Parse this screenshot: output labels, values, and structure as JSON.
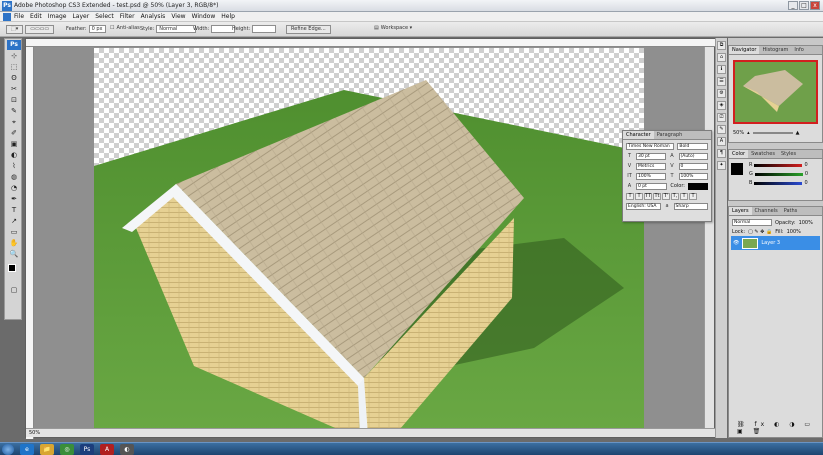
{
  "window": {
    "title": "Adobe Photoshop CS3 Extended - test.psd @ 50% (Layer 3, RGB/8*)",
    "buttons": [
      "_",
      "□",
      "x"
    ]
  },
  "menu": [
    "File",
    "Edit",
    "Image",
    "Layer",
    "Select",
    "Filter",
    "Analysis",
    "View",
    "Window",
    "Help"
  ],
  "options_bar": {
    "feather_label": "Feather:",
    "feather_value": "0 px",
    "antialias_label": "Anti-alias",
    "style_label": "Style:",
    "style_value": "Normal",
    "width_label": "Width:",
    "height_label": "Height:",
    "refine_edge": "Refine Edge...",
    "workspace": "Workspace ▾"
  },
  "tools": [
    "Ps",
    "⊹",
    "⬚",
    "ʘ",
    "✂",
    "⊡",
    "✎",
    "⌖",
    "✐",
    "▣",
    "◐",
    "⌇",
    "◍",
    "◔",
    "✒",
    "T",
    "↗",
    "▭",
    "✋",
    "🔍",
    "⛶",
    "⛶",
    "⛶",
    "⛶",
    "▢"
  ],
  "document": {
    "status_zoom": "50%"
  },
  "dock_icons": [
    "⧉",
    "⌂",
    "ℹ",
    "☰",
    "⚙",
    "◈",
    "⎚",
    "✎",
    "A",
    "¶",
    "✦"
  ],
  "navigator": {
    "tabs": [
      "Navigator",
      "Histogram",
      "Info"
    ],
    "zoom_value": "50%"
  },
  "color_panel": {
    "tabs": [
      "Color",
      "Swatches",
      "Styles"
    ],
    "channels": [
      {
        "label": "R",
        "value": "0",
        "color": "#d21f1f"
      },
      {
        "label": "G",
        "value": "0",
        "color": "#2aa12a"
      },
      {
        "label": "B",
        "value": "0",
        "color": "#2a4bd2"
      }
    ]
  },
  "layers_panel": {
    "tabs": [
      "Layers",
      "Channels",
      "Paths"
    ],
    "blend_mode": "Normal",
    "opacity_label": "Opacity:",
    "opacity_value": "100%",
    "lock_label": "Lock:",
    "fill_label": "Fill:",
    "fill_value": "100%",
    "layer_name": "Layer 3"
  },
  "character_panel": {
    "tabs": [
      "Character",
      "Paragraph"
    ],
    "font_family": "Times New Roman",
    "font_style": "Bold",
    "font_size": "30 pt",
    "leading": "(Auto)",
    "kerning": "Metrics",
    "tracking": "0",
    "vertical_scale": "100%",
    "horizontal_scale": "100%",
    "baseline": "0 pt",
    "color_label": "Color:",
    "language": "English: USA",
    "antialias": "Sharp",
    "style_buttons": [
      "T",
      "T",
      "TT",
      "Tt",
      "T'",
      "T,",
      "T",
      "T"
    ]
  },
  "taskbar": {
    "items": [
      "e",
      "📁",
      "◎",
      "Ps",
      "A",
      "◐"
    ]
  },
  "colors": {
    "accent": "#3a8ee6",
    "grass": "#5e9a3a",
    "roof": "#c9b89a",
    "siding": "#e3cd8e"
  }
}
